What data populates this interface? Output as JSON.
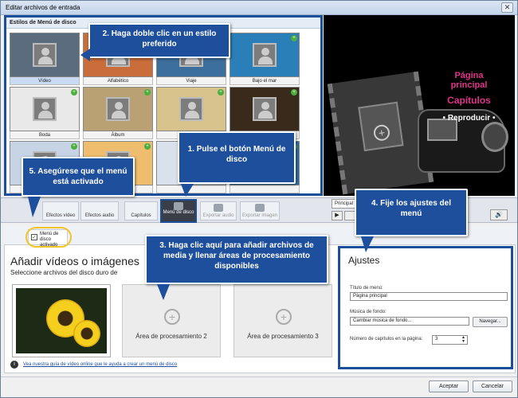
{
  "window": {
    "title": "Editar archivos de entrada",
    "close": "✕"
  },
  "styles_panel": {
    "header": "Estilos de Menú de disco",
    "items": [
      {
        "label": "Vídeo",
        "selected": true,
        "color": "#5a6c7e"
      },
      {
        "label": "Alfabético",
        "color": "#c96d3a"
      },
      {
        "label": "Viaje",
        "color": "#3c6e9e"
      },
      {
        "label": "Bajo el mar",
        "color": "#2a7fb8"
      },
      {
        "label": "Boda",
        "color": "#e9e9e9"
      },
      {
        "label": "Álbum",
        "color": "#b9a173"
      },
      {
        "label": "Pastel",
        "color": "#d8c38d"
      },
      {
        "label": "Capuchino",
        "color": "#3a2a1c"
      },
      {
        "label": "",
        "color": "#c7d4e6"
      },
      {
        "label": "",
        "color": "#efbd6e"
      },
      {
        "label": "",
        "color": "#d8e1ec"
      },
      {
        "label": "",
        "color": "#2e6fa8"
      }
    ]
  },
  "preview": {
    "title_line1": "Página",
    "title_line2": "principal",
    "chapters": "Capítulos",
    "play": "• Reproducir •"
  },
  "toolbar": {
    "buttons": [
      "Efectos vídeo",
      "Efectos audio",
      "Capítulos",
      "Menú de disco",
      "Exportar audio",
      "Exportar imagen"
    ],
    "dropdown": "Principal",
    "volume_icon": "🔊"
  },
  "menu_toggle": {
    "label": "Menú de disco activado",
    "check": "✓"
  },
  "content": {
    "heading": "Añadir vídeos o imágenes",
    "subheading": "Seleccione archivos del disco duro de",
    "area2": "Área de procesamiento 2",
    "area3": "Área de procesamiento 3",
    "plus": "+",
    "guide_link": "Vea nuestra guía de vídeo online que le ayuda a crear un menú de disco",
    "info": "i"
  },
  "settings": {
    "title": "Ajustes",
    "menu_title_label": "Título de menú:",
    "menu_title_value": "Página principal",
    "music_label": "Música de fondo:",
    "music_value": "Cambiar música de fondo...",
    "browse": "Navegar...",
    "chapters_label": "Número de capítulos en la página:",
    "chapters_value": "3"
  },
  "buttons": {
    "accept": "Aceptar",
    "cancel": "Cancelar"
  },
  "callouts": {
    "c1": "1. Pulse el botón Menú de disco",
    "c2": "2. Haga doble clic en un estilo preferido",
    "c3": "3. Haga clic aquí para añadir archivos de media y llenar áreas de procesamiento disponibles",
    "c4": "4. Fije los ajustes del menú",
    "c5": "5. Asegúrese que el menú está activado"
  },
  "colors": {
    "accent": "#1e4f9c",
    "highlight": "#f2c428",
    "pink": "#e0338b"
  }
}
